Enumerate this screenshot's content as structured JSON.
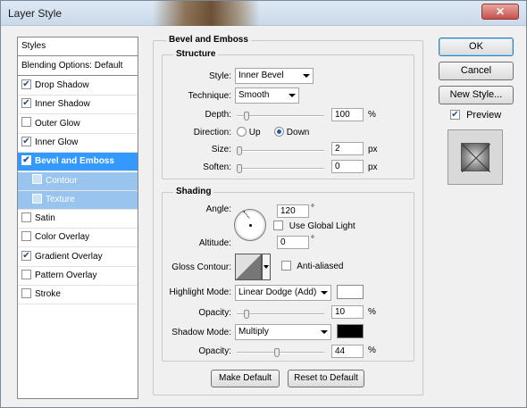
{
  "window": {
    "title": "Layer Style",
    "close_glyph": "✕"
  },
  "styles_list": {
    "header": "Styles",
    "blending": "Blending Options: Default",
    "items": [
      {
        "label": "Drop Shadow",
        "checked": true
      },
      {
        "label": "Inner Shadow",
        "checked": true
      },
      {
        "label": "Outer Glow",
        "checked": false
      },
      {
        "label": "Inner Glow",
        "checked": true
      },
      {
        "label": "Bevel and Emboss",
        "checked": true,
        "selected": true
      },
      {
        "label": "Contour",
        "checked": false,
        "sub": true
      },
      {
        "label": "Texture",
        "checked": false,
        "sub": true
      },
      {
        "label": "Satin",
        "checked": false
      },
      {
        "label": "Color Overlay",
        "checked": false
      },
      {
        "label": "Gradient Overlay",
        "checked": true
      },
      {
        "label": "Pattern Overlay",
        "checked": false
      },
      {
        "label": "Stroke",
        "checked": false
      }
    ]
  },
  "bevel": {
    "title": "Bevel and Emboss",
    "structure_title": "Structure",
    "style_label": "Style:",
    "style_value": "Inner Bevel",
    "technique_label": "Technique:",
    "technique_value": "Smooth",
    "depth_label": "Depth:",
    "depth_value": "100",
    "depth_unit": "%",
    "direction_label": "Direction:",
    "direction_up": "Up",
    "direction_down": "Down",
    "size_label": "Size:",
    "size_value": "2",
    "size_unit": "px",
    "soften_label": "Soften:",
    "soften_value": "0",
    "soften_unit": "px",
    "shading_title": "Shading",
    "angle_label": "Angle:",
    "angle_value": "120",
    "angle_unit": "°",
    "global_light_label": "Use Global Light",
    "altitude_label": "Altitude:",
    "altitude_value": "0",
    "altitude_unit": "°",
    "gloss_label": "Gloss Contour:",
    "antialiased_label": "Anti-aliased",
    "highlight_mode_label": "Highlight Mode:",
    "highlight_mode_value": "Linear Dodge (Add)",
    "highlight_color": "#ffffff",
    "highlight_opacity_label": "Opacity:",
    "highlight_opacity_value": "10",
    "highlight_opacity_unit": "%",
    "shadow_mode_label": "Shadow Mode:",
    "shadow_mode_value": "Multiply",
    "shadow_color": "#000000",
    "shadow_opacity_label": "Opacity:",
    "shadow_opacity_value": "44",
    "shadow_opacity_unit": "%",
    "make_default": "Make Default",
    "reset_default": "Reset to Default"
  },
  "actions": {
    "ok": "OK",
    "cancel": "Cancel",
    "new_style": "New Style...",
    "preview_label": "Preview",
    "preview_checked": true
  }
}
